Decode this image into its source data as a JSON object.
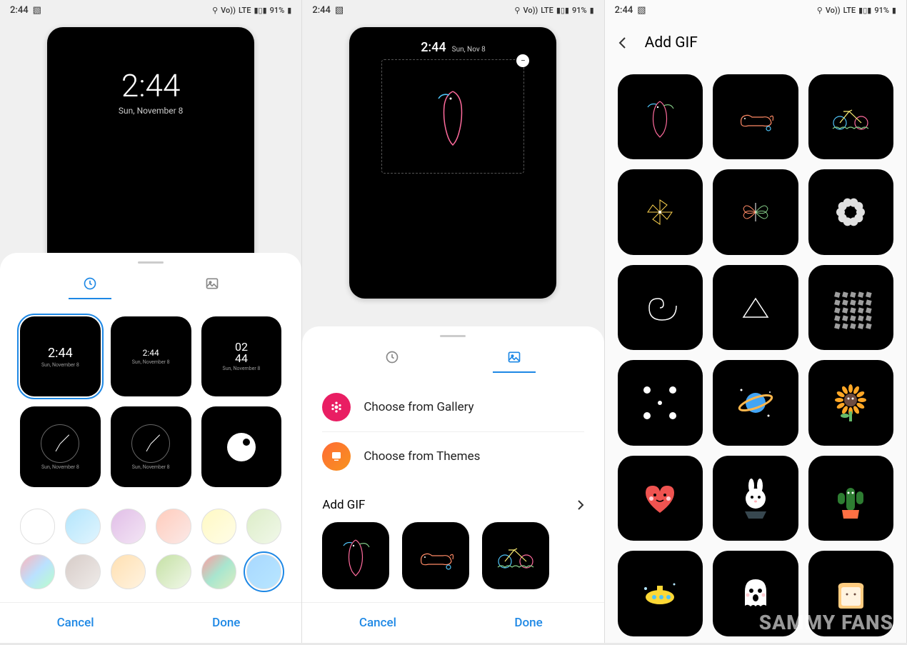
{
  "status": {
    "time": "2:44",
    "signal": "LTE",
    "battery": "91%",
    "volte": "Vo))"
  },
  "screen1": {
    "preview": {
      "time": "2:44",
      "date": "Sun, November 8"
    },
    "clocks": [
      {
        "time": "2:44",
        "date": "Sun, November 8",
        "style": "large",
        "selected": true
      },
      {
        "time": "2:44",
        "date": "Sun, November 8",
        "style": "small"
      },
      {
        "time": "02\n44",
        "date": "Sun, November 8",
        "style": "digital"
      },
      {
        "date": "Sun, November 8",
        "style": "analog"
      },
      {
        "date": "Sun, November 8",
        "style": "analog"
      },
      {
        "style": "simple"
      }
    ],
    "colors": [
      {
        "css": "#fff"
      },
      {
        "css": "linear-gradient(135deg,#b3e5fc,#e1f5fe)"
      },
      {
        "css": "linear-gradient(135deg,#e1bee7,#f3e5f5)"
      },
      {
        "css": "linear-gradient(135deg,#ffccbc,#fbe9e7)"
      },
      {
        "css": "linear-gradient(135deg,#fff9c4,#fffde7)"
      },
      {
        "css": "linear-gradient(135deg,#dcedc8,#f1f8e9)"
      },
      {
        "css": "linear-gradient(135deg,#ffb3ba,#bae1ff,#baffc9)"
      },
      {
        "css": "linear-gradient(135deg,#d7ccc8,#efebe9)"
      },
      {
        "css": "linear-gradient(135deg,#ffe0b2,#fff3e0)"
      },
      {
        "css": "linear-gradient(135deg,#c5e1a5,#f1f8e9)"
      },
      {
        "css": "linear-gradient(135deg,#ff9a9e,#a8e6cf,#dcedc1)"
      },
      {
        "css": "linear-gradient(135deg,#a8d8ff,#b8e6ff)",
        "selected": true
      }
    ],
    "cancel": "Cancel",
    "done": "Done"
  },
  "screen2": {
    "preview": {
      "time": "2:44",
      "date": "Sun, Nov 8"
    },
    "gallery": "Choose from Gallery",
    "themes": "Choose from Themes",
    "addgif": "Add GIF",
    "gifs": [
      "parrot",
      "cat",
      "bicycle"
    ],
    "cancel": "Cancel",
    "done": "Done"
  },
  "screen3": {
    "title": "Add GIF",
    "gifs": [
      "parrot",
      "cat",
      "bicycle",
      "pinwheel",
      "butterfly",
      "flower-ring",
      "spiral",
      "triangle",
      "cubes",
      "dots",
      "planet",
      "sunflower",
      "heart",
      "bunny",
      "cactus",
      "submarine",
      "ghost",
      "toast"
    ]
  },
  "watermark": "SAMMY FANS"
}
